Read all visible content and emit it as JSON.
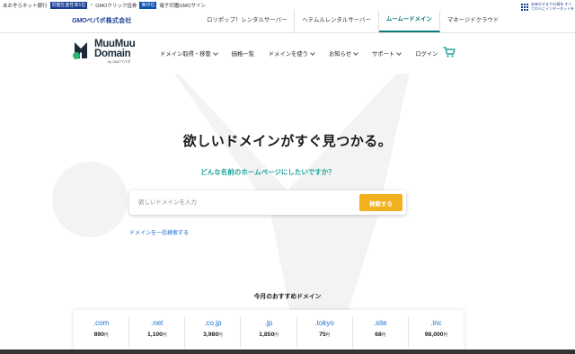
{
  "topbar": {
    "site_name": "あおぞらネット銀行",
    "badge1": "労働生産性率1位",
    "item2": "GMOクリック証券",
    "badge2": "実印位",
    "item3": "電子印鑑GMOサイン"
  },
  "gmobar": {
    "logo_gmo": "GMO",
    "logo_text": "ペパボ株式会社",
    "links": [
      "ロリポップ！レンタルサーバー",
      "ヘテムルレンタルサーバー",
      "ムームードメイン",
      "マネージドクラウド"
    ],
    "sustain_text": "未来のすまで25周年 すべての人にインターネットを"
  },
  "header": {
    "logo_line1": "MuuMuu",
    "logo_line2": "Domain",
    "logo_sub": "by GMOペパボ",
    "nav": [
      "ドメイン取得・移管",
      "価格一覧",
      "ドメインを使う",
      "お知らせ",
      "サポート",
      "ログイン"
    ]
  },
  "hero": {
    "title": "欲しいドメインがすぐ見つかる。",
    "subtitle": "どんな名前のホームページにしたいですか？",
    "search_placeholder": "欲しいドメインを入力",
    "search_button": "検索する",
    "bulk_link": "ドメインを一括検索する"
  },
  "recommend": {
    "title": "今月のおすすめドメイン",
    "items": [
      {
        "name": ".com",
        "price": "890",
        "unit": "円"
      },
      {
        "name": ".net",
        "price": "1,100",
        "unit": "円"
      },
      {
        "name": ".co.jp",
        "price": "3,980",
        "unit": "円"
      },
      {
        "name": ".jp",
        "price": "1,850",
        "unit": "円"
      },
      {
        "name": ".tokyo",
        "price": "75",
        "unit": "円"
      },
      {
        "name": ".site",
        "price": "68",
        "unit": "円"
      },
      {
        "name": ".inc",
        "price": "98,000",
        "unit": "円"
      }
    ]
  },
  "colors": {
    "accent_teal": "#1aa59a",
    "button_yellow": "#f2b01e",
    "link_blue": "#1a6fd0",
    "gmo_blue": "#1c3f94"
  }
}
